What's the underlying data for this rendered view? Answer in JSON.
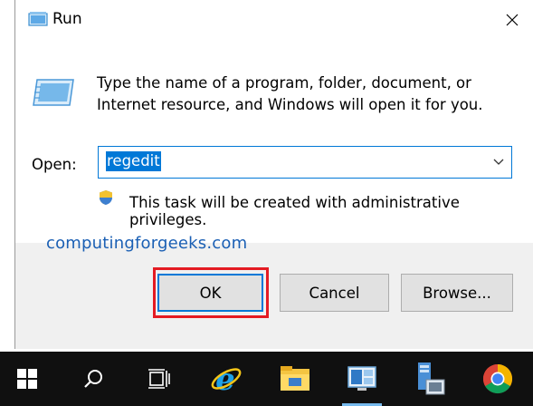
{
  "dialog": {
    "title": "Run",
    "description": "Type the name of a program, folder, document, or Internet resource, and Windows will open it for you.",
    "open_label": "Open:",
    "open_value": "regedit",
    "admin_note": "This task will be created with administrative privileges.",
    "buttons": {
      "ok": "OK",
      "cancel": "Cancel",
      "browse": "Browse..."
    }
  },
  "watermark": "computingforgeeks.com",
  "colors": {
    "selection": "#0078d7",
    "highlight_box": "#e41b23",
    "taskbar": "#101010",
    "dialog_bg": "#f0f0f0"
  },
  "taskbar": {
    "items": [
      {
        "name": "start-icon"
      },
      {
        "name": "search-icon"
      },
      {
        "name": "task-view-icon"
      },
      {
        "name": "internet-explorer-icon"
      },
      {
        "name": "file-explorer-icon"
      },
      {
        "name": "server-manager-icon"
      },
      {
        "name": "powershell-icon"
      },
      {
        "name": "chrome-icon"
      }
    ]
  }
}
